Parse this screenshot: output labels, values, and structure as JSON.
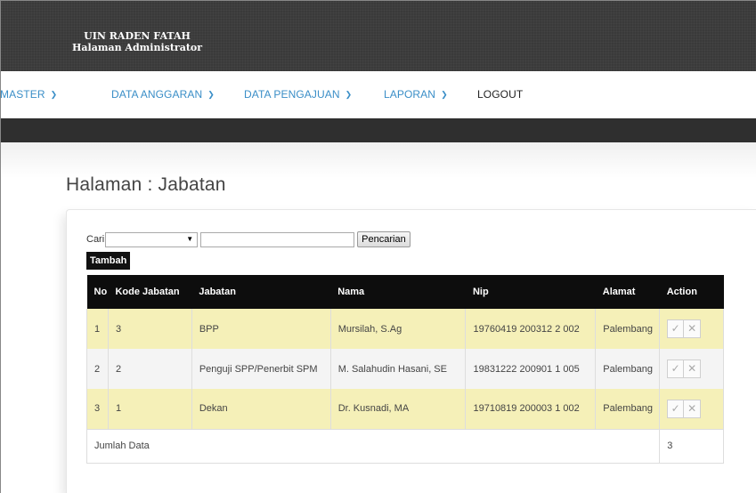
{
  "header": {
    "brand_line1": "UIN RADEN FATAH",
    "brand_line2": "Halaman Administrator"
  },
  "nav": [
    {
      "label": "MASTER",
      "has_dropdown": true
    },
    {
      "label": "DATA ANGGARAN",
      "has_dropdown": true
    },
    {
      "label": "DATA PENGAJUAN",
      "has_dropdown": true
    },
    {
      "label": "LAPORAN",
      "has_dropdown": true
    },
    {
      "label": "LOGOUT",
      "has_dropdown": false
    }
  ],
  "page": {
    "title": "Halaman : Jabatan"
  },
  "search": {
    "label": "Cari",
    "select_value": "",
    "input_value": "",
    "button_label": "Pencarian"
  },
  "toolbar": {
    "add_label": "Tambah"
  },
  "table": {
    "headers": [
      "No",
      "Kode Jabatan",
      "Jabatan",
      "Nama",
      "Nip",
      "Alamat",
      "Action"
    ],
    "rows": [
      {
        "no": "1",
        "kode": "3",
        "jabatan": "BPP",
        "nama": "Mursilah, S.Ag",
        "nip": "19760419 200312 2 002",
        "alamat": "Palembang"
      },
      {
        "no": "2",
        "kode": "2",
        "jabatan": "Penguji SPP/Penerbit SPM",
        "nama": "M. Salahudin Hasani, SE",
        "nip": "19831222 200901 1 005",
        "alamat": "Palembang"
      },
      {
        "no": "3",
        "kode": "1",
        "jabatan": "Dekan",
        "nama": "Dr. Kusnadi, MA",
        "nip": "19710819 200003 1 002",
        "alamat": "Palembang"
      }
    ],
    "footer_label": "Jumlah Data",
    "footer_count": "3"
  },
  "icons": {
    "dropdown": "chevron-down-icon",
    "edit": "check-icon",
    "delete": "close-icon"
  },
  "colors": {
    "header_bg": "#3a3a3a",
    "nav_link": "#3a8ec7",
    "row_highlight": "#f5f0b8",
    "table_header": "#0d0d0d"
  }
}
